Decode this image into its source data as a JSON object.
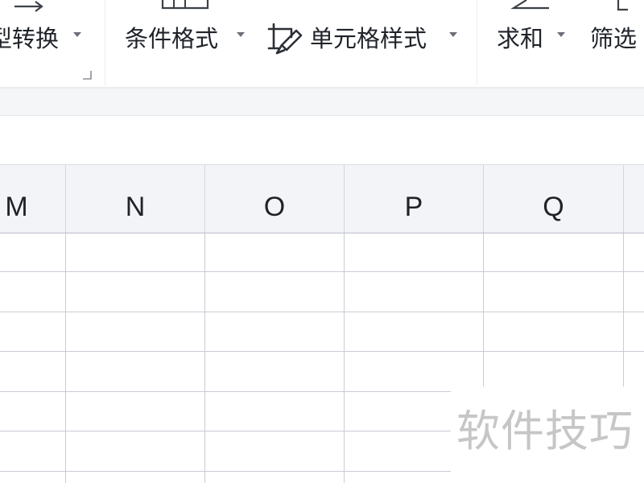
{
  "ribbon": {
    "type_convert": {
      "label": "型转换",
      "icon": "swap-arrow-icon"
    },
    "conditional_format": {
      "label": "条件格式",
      "icon": "conditional-format-icon"
    },
    "cell_style": {
      "label": "单元格样式",
      "icon": "cell-style-brush-icon"
    },
    "sum": {
      "label": "求和",
      "icon": "sum-sigma-icon"
    },
    "filter": {
      "label": "筛选",
      "icon": "filter-icon"
    }
  },
  "grid": {
    "columns": [
      "M",
      "N",
      "O",
      "P",
      "Q"
    ],
    "visible_rows": 6
  },
  "watermark": {
    "text": "软件技巧"
  },
  "colors": {
    "text": "#1f2329",
    "gridline": "#c9ccd6",
    "header_bg": "#f3f4f7",
    "band_bg": "#f5f6f8"
  }
}
